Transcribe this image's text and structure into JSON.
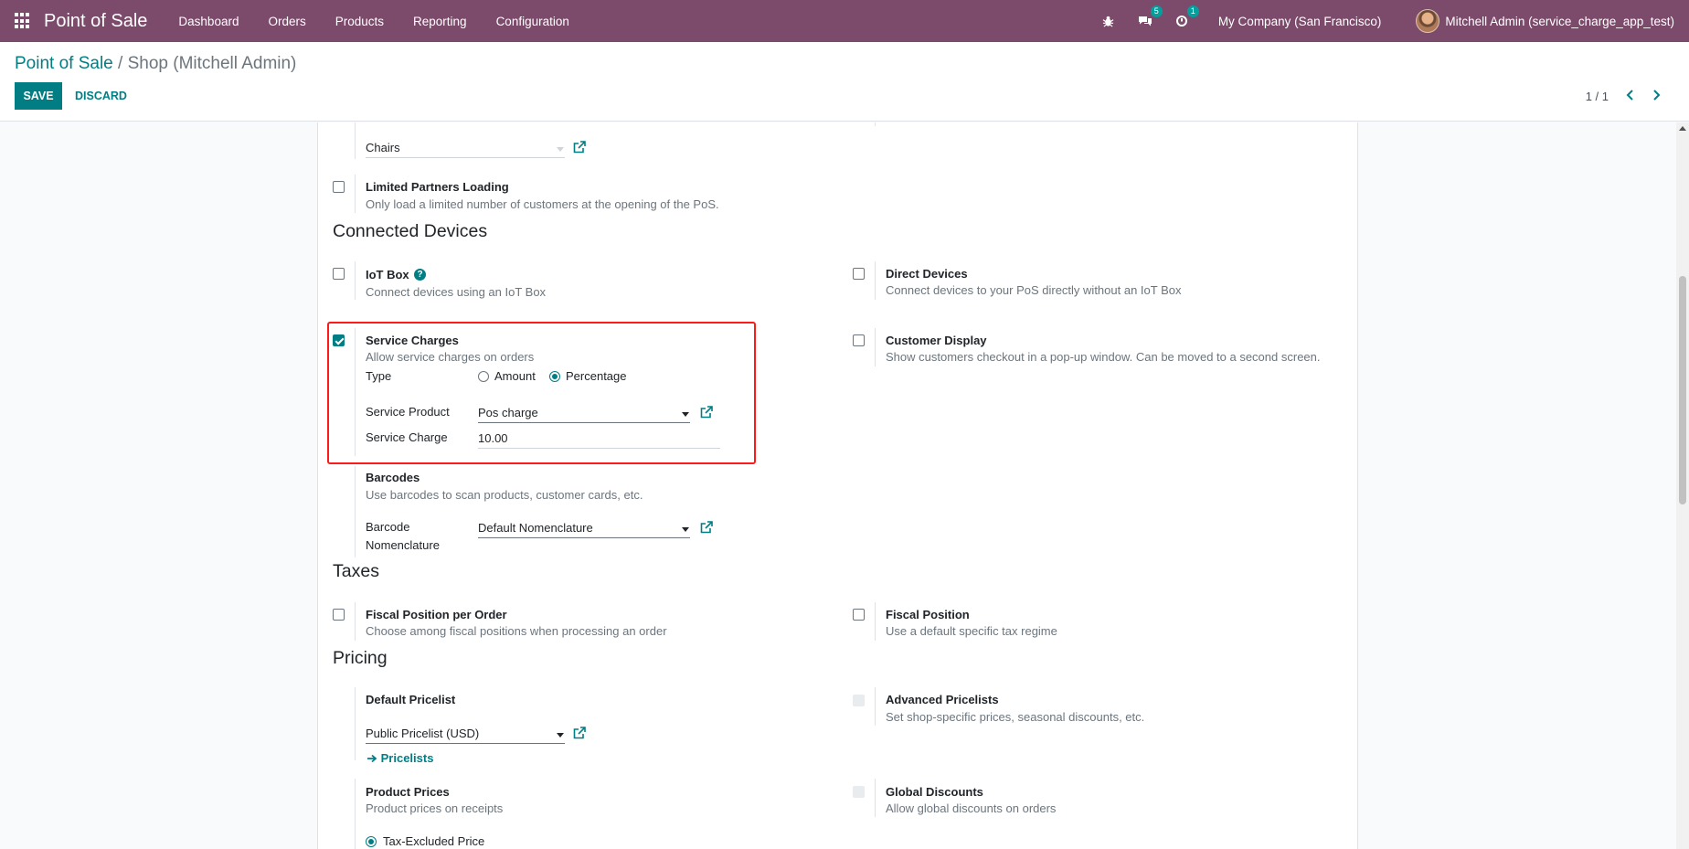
{
  "navbar": {
    "app_title": "Point of Sale",
    "menu": [
      "Dashboard",
      "Orders",
      "Products",
      "Reporting",
      "Configuration"
    ],
    "messages_count": "5",
    "activities_count": "1",
    "company": "My Company (San Francisco)",
    "user": "Mitchell Admin (service_charge_app_test)",
    "brand_color": "#7c4a6b"
  },
  "control_panel": {
    "breadcrumb_parent": "Point of Sale",
    "breadcrumb_separator": " / ",
    "breadcrumb_current": "Shop (Mitchell Admin)",
    "save_label": "SAVE",
    "discard_label": "DISCARD",
    "pager": "1 / 1"
  },
  "form": {
    "chairs_field": "Chairs",
    "limited_partners": {
      "title": "Limited Partners Loading",
      "help": "Only load a limited number of customers at the opening of the PoS."
    },
    "connected_devices": {
      "heading": "Connected Devices",
      "iot_box": {
        "title": "IoT Box",
        "help": "Connect devices using an IoT Box"
      },
      "direct_devices": {
        "title": "Direct Devices",
        "help": "Connect devices to your PoS directly without an IoT Box"
      },
      "service_charges": {
        "title": "Service Charges",
        "help": "Allow service charges on orders",
        "type_label": "Type",
        "type_options": [
          "Amount",
          "Percentage"
        ],
        "type_selected": "Percentage",
        "product_label": "Service Product",
        "product_value": "Pos charge",
        "charge_label": "Service Charge",
        "charge_value": "10.00"
      },
      "customer_display": {
        "title": "Customer Display",
        "help": "Show customers checkout in a pop-up window. Can be moved to a second screen."
      },
      "barcodes": {
        "title": "Barcodes",
        "help": "Use barcodes to scan products, customer cards, etc.",
        "nomenclature_label_1": "Barcode",
        "nomenclature_label_2": "Nomenclature",
        "nomenclature_value": "Default Nomenclature"
      }
    },
    "taxes": {
      "heading": "Taxes",
      "fiscal_position_per_order": {
        "title": "Fiscal Position per Order",
        "help": "Choose among fiscal positions when processing an order"
      },
      "fiscal_position": {
        "title": "Fiscal Position",
        "help": "Use a default specific tax regime"
      }
    },
    "pricing": {
      "heading": "Pricing",
      "default_pricelist": {
        "title": "Default Pricelist",
        "value": "Public Pricelist (USD)",
        "link": "Pricelists"
      },
      "advanced_pricelists": {
        "title": "Advanced Pricelists",
        "help": "Set shop-specific prices, seasonal discounts, etc."
      },
      "product_prices": {
        "title": "Product Prices",
        "help": "Product prices on receipts",
        "option": "Tax-Excluded Price"
      },
      "global_discounts": {
        "title": "Global Discounts",
        "help": "Allow global discounts on orders"
      }
    }
  }
}
